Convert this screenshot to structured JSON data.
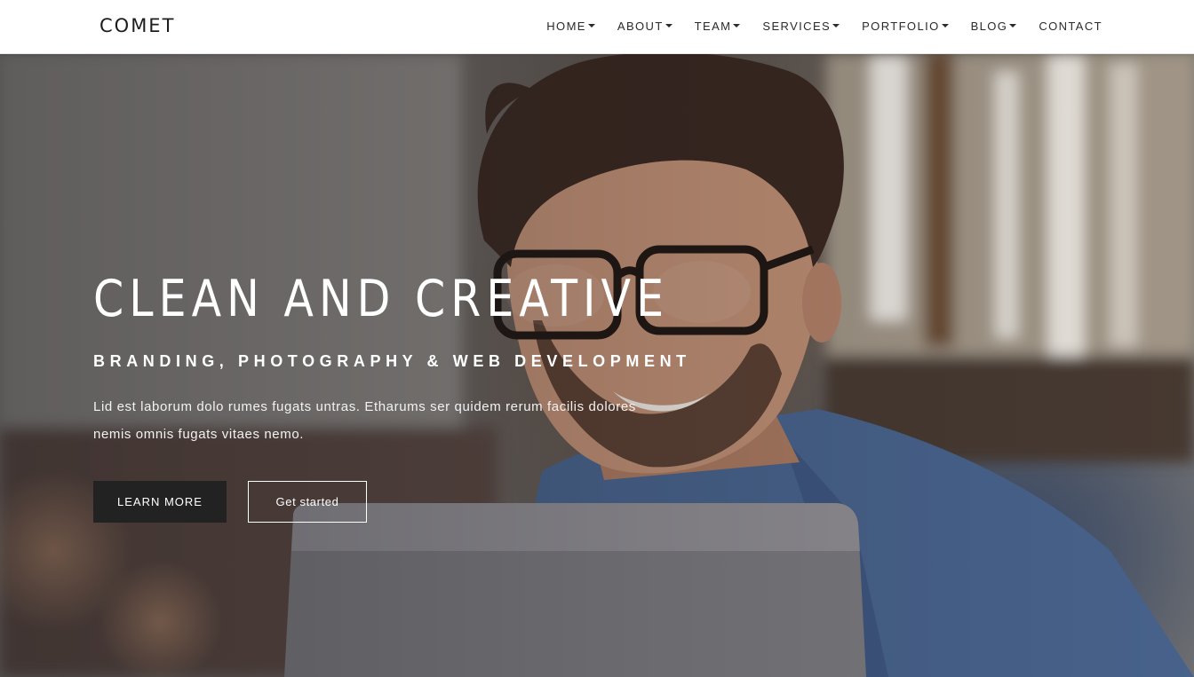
{
  "header": {
    "logo": "COMET",
    "nav": [
      {
        "label": "HOME",
        "has_dropdown": true
      },
      {
        "label": "ABOUT",
        "has_dropdown": true
      },
      {
        "label": "TEAM",
        "has_dropdown": true
      },
      {
        "label": "SERVICES",
        "has_dropdown": true
      },
      {
        "label": "PORTFOLIO",
        "has_dropdown": true
      },
      {
        "label": "BLOG",
        "has_dropdown": true
      },
      {
        "label": "CONTACT",
        "has_dropdown": false
      }
    ]
  },
  "hero": {
    "title": "CLEAN AND CREATIVE",
    "subtitle": "BRANDING, PHOTOGRAPHY & WEB DEVELOPMENT",
    "text": "Lid est laborum dolo rumes fugats untras. Etharums ser quidem rerum facilis dolores nemis omnis fugats vitaes nemo.",
    "primary_button": "LEARN MORE",
    "secondary_button": "Get started"
  },
  "colors": {
    "header_bg": "#ffffff",
    "nav_text": "#2a2a2a",
    "primary_button_bg": "#222222",
    "hero_text": "#ffffff"
  }
}
